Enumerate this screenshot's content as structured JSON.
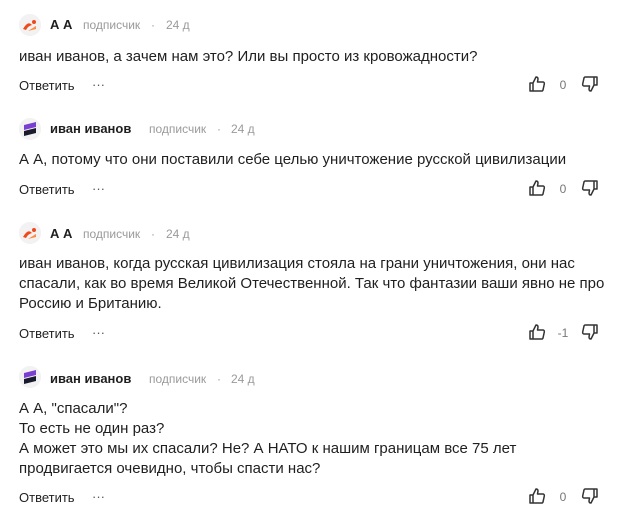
{
  "comments": [
    {
      "author": "А А",
      "badge": "подписчик",
      "dot": "·",
      "time": "24 д",
      "text": "иван иванов, а зачем нам это? Или вы просто из кровожадности?",
      "reply_label": "Ответить",
      "more_label": "···",
      "score": "0",
      "avatar": "orange-red-logo"
    },
    {
      "author": "иван иванов",
      "badge": "подписчик",
      "dot": "·",
      "time": "24 д",
      "text": "А А, потому что они поставили себе целью уничтожение русской цивилизации",
      "reply_label": "Ответить",
      "more_label": "···",
      "score": "0",
      "avatar": "purple-stripe-logo"
    },
    {
      "author": "А А",
      "badge": "подписчик",
      "dot": "·",
      "time": "24 д",
      "text": "иван иванов, когда русская цивилизация стояла на грани уничтожения, они нас\nспасали, как во время Великой Отечественной. Так что фантазии ваши явно не про\nРоссию и Британию.",
      "reply_label": "Ответить",
      "more_label": "···",
      "score": "-1",
      "avatar": "orange-red-logo"
    },
    {
      "author": "иван иванов",
      "badge": "подписчик",
      "dot": "·",
      "time": "24 д",
      "text": "А А, \"спасали\"?\nТо есть не один раз?\nА может это мы их спасали? Не? А НАТО  к нашим границам все 75 лет\nпродвигается очевидно, чтобы спасти нас?",
      "reply_label": "Ответить",
      "more_label": "···",
      "score": "0",
      "avatar": "purple-stripe-logo"
    }
  ],
  "colors": {
    "text": "#1f1f1f",
    "meta": "#9a9a9a",
    "avatar_orange": "#f04a1c",
    "avatar_purple": "#7a3fd0"
  }
}
